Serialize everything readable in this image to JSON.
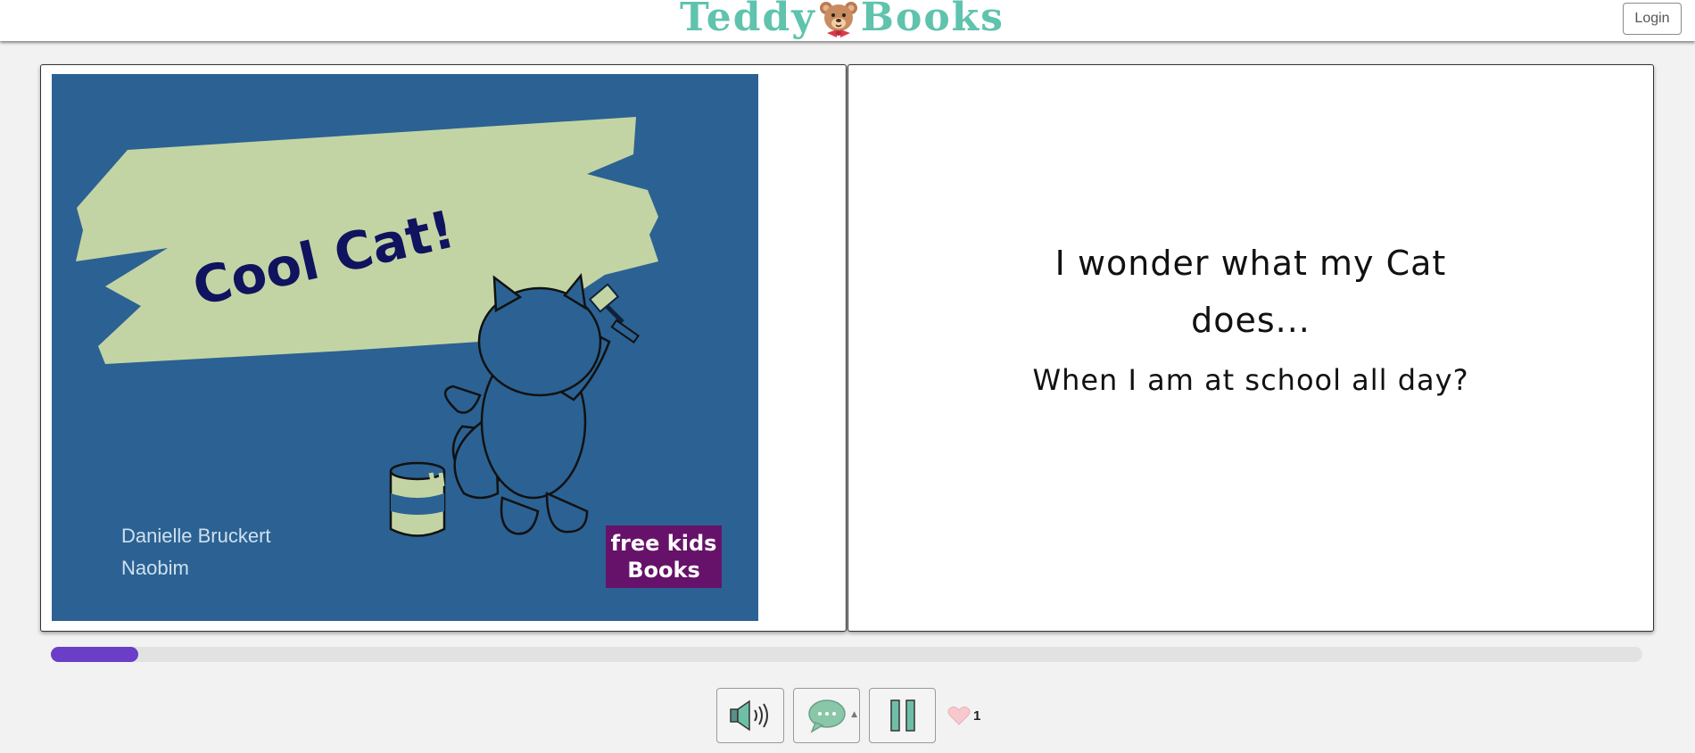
{
  "header": {
    "logo_left": "Teddy",
    "logo_right": "Books",
    "login_label": "Login"
  },
  "book": {
    "cover": {
      "title": "Cool Cat!",
      "author": "Danielle Bruckert",
      "illustrator": "Naobim",
      "badge_line1": "free kids",
      "badge_line2": "Books"
    },
    "story": {
      "line1": "I wonder what my Cat",
      "line2": "does...",
      "line3": "When I am at school all day?"
    }
  },
  "progress": {
    "fraction": 0.055
  },
  "controls": {
    "sound_icon": "speaker-icon",
    "chat_icon": "speech-bubble-icon",
    "pause_icon": "pause-icon",
    "likes_count": "1"
  },
  "colors": {
    "brand": "#5fc3ad",
    "cover_bg": "#2b6293",
    "paint": "#c3d4a4",
    "progress": "#6a3ec7",
    "badge": "#66126a"
  }
}
